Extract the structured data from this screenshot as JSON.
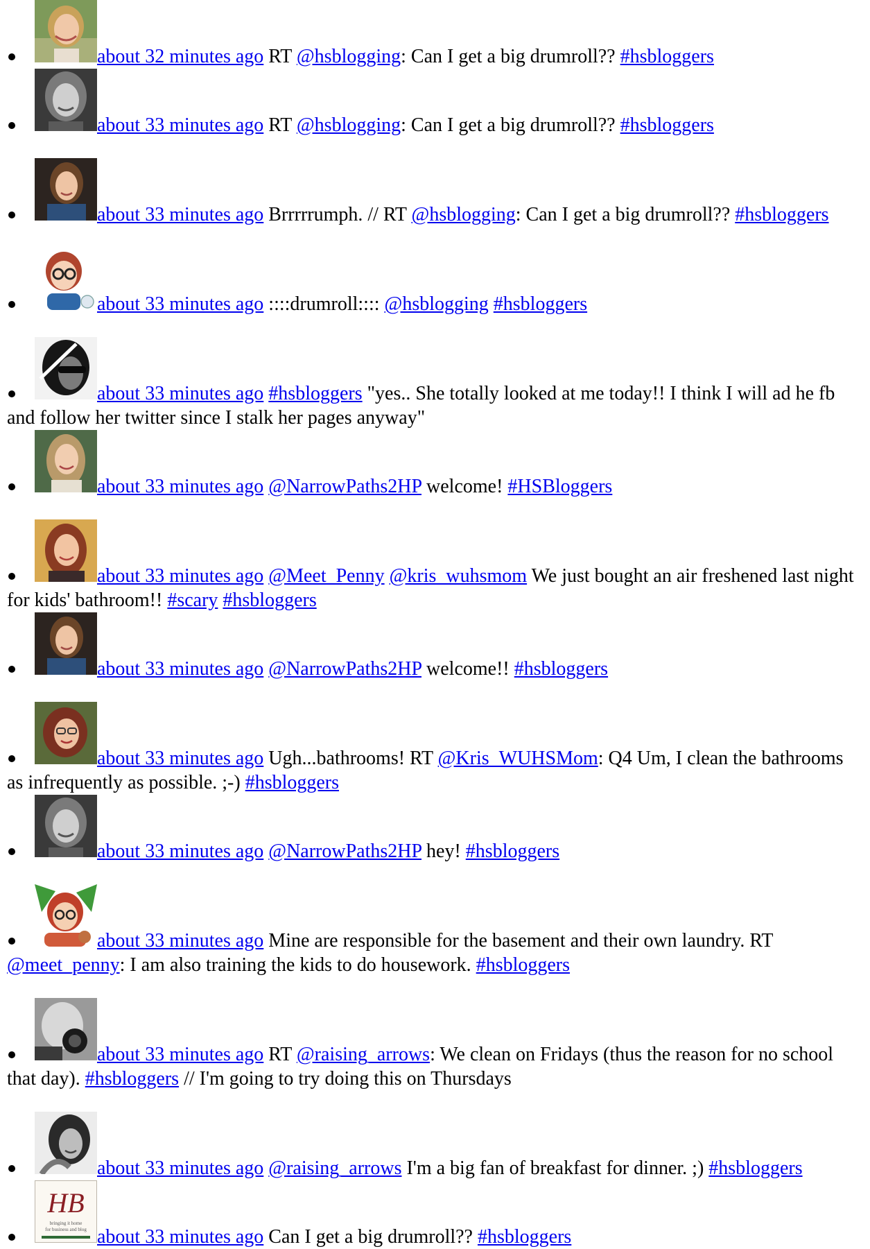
{
  "tweets": [
    {
      "avatar": "avatar-blonde-woman-smiling",
      "time": "about 32 minutes ago",
      "parts": [
        {
          "t": "text",
          "v": "RT "
        },
        {
          "t": "link",
          "v": "@hsblogging"
        },
        {
          "t": "text",
          "v": ": Can I get a big drumroll?? "
        },
        {
          "t": "link",
          "v": "#hsbloggers"
        }
      ]
    },
    {
      "avatar": "avatar-grayscale-woman",
      "time": "about 33 minutes ago",
      "parts": [
        {
          "t": "text",
          "v": "RT "
        },
        {
          "t": "link",
          "v": "@hsblogging"
        },
        {
          "t": "text",
          "v": ": Can I get a big drumroll?? "
        },
        {
          "t": "link",
          "v": "#hsbloggers"
        }
      ]
    },
    {
      "avatar": "avatar-woman-brown-hair-blue-top",
      "time": "about 33 minutes ago",
      "parts": [
        {
          "t": "text",
          "v": "Brrrrrumph. // RT "
        },
        {
          "t": "link",
          "v": "@hsblogging"
        },
        {
          "t": "text",
          "v": ": Can I get a big drumroll?? "
        },
        {
          "t": "link",
          "v": "#hsbloggers"
        }
      ]
    },
    {
      "avatar": "avatar-cartoon-glasses",
      "time": "about 33 minutes ago",
      "parts": [
        {
          "t": "text",
          "v": "::::drumroll:::: "
        },
        {
          "t": "link",
          "v": "@hsblogging"
        },
        {
          "t": "text",
          "v": " "
        },
        {
          "t": "link",
          "v": "#hsbloggers"
        }
      ]
    },
    {
      "avatar": "avatar-man-sunglasses-bw",
      "time": "about 33 minutes ago",
      "parts": [
        {
          "t": "link",
          "v": "#hsbloggers"
        },
        {
          "t": "text",
          "v": " \"yes.. She totally looked at me today!! I think I will ad he fb and follow her twitter since I stalk her pages anyway\""
        }
      ]
    },
    {
      "avatar": "avatar-woman-long-hair-outdoors",
      "time": "about 33 minutes ago",
      "parts": [
        {
          "t": "link",
          "v": "@NarrowPaths2HP"
        },
        {
          "t": "text",
          "v": " welcome! "
        },
        {
          "t": "link",
          "v": "#HSBloggers"
        }
      ]
    },
    {
      "avatar": "avatar-woman-auburn-hair",
      "time": "about 33 minutes ago",
      "parts": [
        {
          "t": "link",
          "v": "@Meet_Penny"
        },
        {
          "t": "text",
          "v": " "
        },
        {
          "t": "link",
          "v": "@kris_wuhsmom"
        },
        {
          "t": "text",
          "v": " We just bought an air freshened last night for kids' bathroom!! "
        },
        {
          "t": "link",
          "v": "#scary"
        },
        {
          "t": "text",
          "v": " "
        },
        {
          "t": "link",
          "v": "#hsbloggers"
        }
      ]
    },
    {
      "avatar": "avatar-woman-brown-hair-blue-top",
      "time": "about 33 minutes ago",
      "parts": [
        {
          "t": "link",
          "v": "@NarrowPaths2HP"
        },
        {
          "t": "text",
          "v": " welcome!! "
        },
        {
          "t": "link",
          "v": "#hsbloggers"
        }
      ]
    },
    {
      "avatar": "avatar-woman-glasses-red-hair",
      "time": "about 33 minutes ago",
      "parts": [
        {
          "t": "text",
          "v": "Ugh...bathrooms! RT "
        },
        {
          "t": "link",
          "v": "@Kris_WUHSMom"
        },
        {
          "t": "text",
          "v": ": Q4 Um, I clean the bathrooms as infrequently as possible. ;-) "
        },
        {
          "t": "link",
          "v": "#hsbloggers"
        }
      ]
    },
    {
      "avatar": "avatar-grayscale-woman",
      "time": "about 33 minutes ago",
      "parts": [
        {
          "t": "link",
          "v": "@NarrowPaths2HP"
        },
        {
          "t": "text",
          "v": " hey! "
        },
        {
          "t": "link",
          "v": "#hsbloggers"
        }
      ]
    },
    {
      "avatar": "avatar-cartoon-red-hair",
      "time": "about 33 minutes ago",
      "parts": [
        {
          "t": "text",
          "v": "Mine are responsible for the basement and their own laundry. RT "
        },
        {
          "t": "link",
          "v": "@meet_penny"
        },
        {
          "t": "text",
          "v": ": I am also training the kids to do housework. "
        },
        {
          "t": "link",
          "v": "#hsbloggers"
        }
      ]
    },
    {
      "avatar": "avatar-camera-bw",
      "time": "about 33 minutes ago",
      "parts": [
        {
          "t": "text",
          "v": "RT "
        },
        {
          "t": "link",
          "v": "@raising_arrows"
        },
        {
          "t": "text",
          "v": ": We clean on Fridays (thus the reason for no school that day). "
        },
        {
          "t": "link",
          "v": "#hsbloggers"
        },
        {
          "t": "text",
          "v": " // I'm going to try doing this on Thursdays"
        }
      ]
    },
    {
      "avatar": "avatar-woman-bw-smiling",
      "time": "about 33 minutes ago",
      "parts": [
        {
          "t": "link",
          "v": "@raising_arrows"
        },
        {
          "t": "text",
          "v": " I'm a big fan of breakfast for dinner. ;) "
        },
        {
          "t": "link",
          "v": "#hsbloggers"
        }
      ]
    },
    {
      "avatar": "avatar-hb-logo",
      "logo_text": "HB",
      "logo_tagline": "bringing it home for business and blog",
      "time": "about 33 minutes ago",
      "parts": [
        {
          "t": "text",
          "v": "Can I get a big drumroll?? "
        },
        {
          "t": "link",
          "v": "#hsbloggers"
        }
      ]
    }
  ],
  "colors": {
    "link": "#0000ee",
    "text": "#000000",
    "background": "#ffffff"
  }
}
